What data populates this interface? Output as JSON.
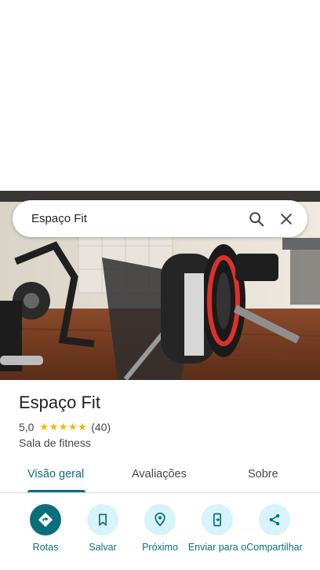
{
  "search": {
    "query": "Espaço Fit"
  },
  "place": {
    "title": "Espaço Fit",
    "rating": "5,0",
    "stars": "★★★★★",
    "review_count": "(40)",
    "category": "Sala de fitness"
  },
  "tabs": [
    {
      "label": "Visão geral",
      "active": true
    },
    {
      "label": "Avaliações",
      "active": false
    },
    {
      "label": "Sobre",
      "active": false
    }
  ],
  "actions": [
    {
      "label": "Rotas",
      "icon": "directions-icon"
    },
    {
      "label": "Salvar",
      "icon": "bookmark-icon"
    },
    {
      "label": "Próximo",
      "icon": "nearby-icon"
    },
    {
      "label": "Enviar para o",
      "icon": "send-to-phone-icon"
    },
    {
      "label": "Compartilhar",
      "icon": "share-icon"
    }
  ],
  "colors": {
    "accent": "#0b6e7a",
    "action_bg": "#d6f4fa",
    "star": "#f4b400"
  }
}
